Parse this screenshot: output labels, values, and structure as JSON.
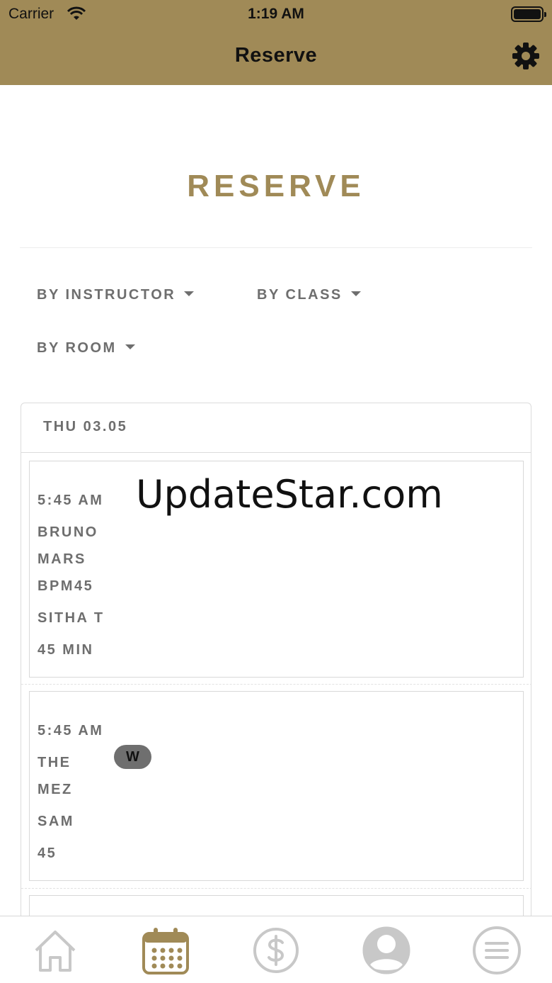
{
  "status_bar": {
    "carrier": "Carrier",
    "time": "1:19 AM"
  },
  "nav": {
    "title": "Reserve",
    "settings_icon": "gear-icon"
  },
  "page": {
    "heading": "RESERVE"
  },
  "filters": [
    {
      "label": "BY INSTRUCTOR"
    },
    {
      "label": "BY CLASS"
    },
    {
      "label": "BY ROOM"
    }
  ],
  "schedule": {
    "day": "THU 03.05",
    "classes": [
      {
        "time": "5:45 AM",
        "name_1": "BRUNO",
        "name_2": "MARS",
        "name_3": "BPM45",
        "instructor": "SITHA T",
        "duration": "45 MIN"
      },
      {
        "time": "5:45 AM",
        "name_1": "THE",
        "name_2": "MEZ",
        "instructor": "SAM",
        "duration": "45",
        "badge": "W"
      }
    ]
  },
  "watermark": "UpdateStar.com",
  "tabs": [
    {
      "icon": "home-icon",
      "active": false
    },
    {
      "icon": "calendar-icon",
      "active": true
    },
    {
      "icon": "dollar-icon",
      "active": false
    },
    {
      "icon": "profile-icon",
      "active": false
    },
    {
      "icon": "menu-icon",
      "active": false
    }
  ],
  "colors": {
    "brand": "#a08a57",
    "text": "#6e6e6e",
    "inactive_icon": "#c8c8c8"
  }
}
